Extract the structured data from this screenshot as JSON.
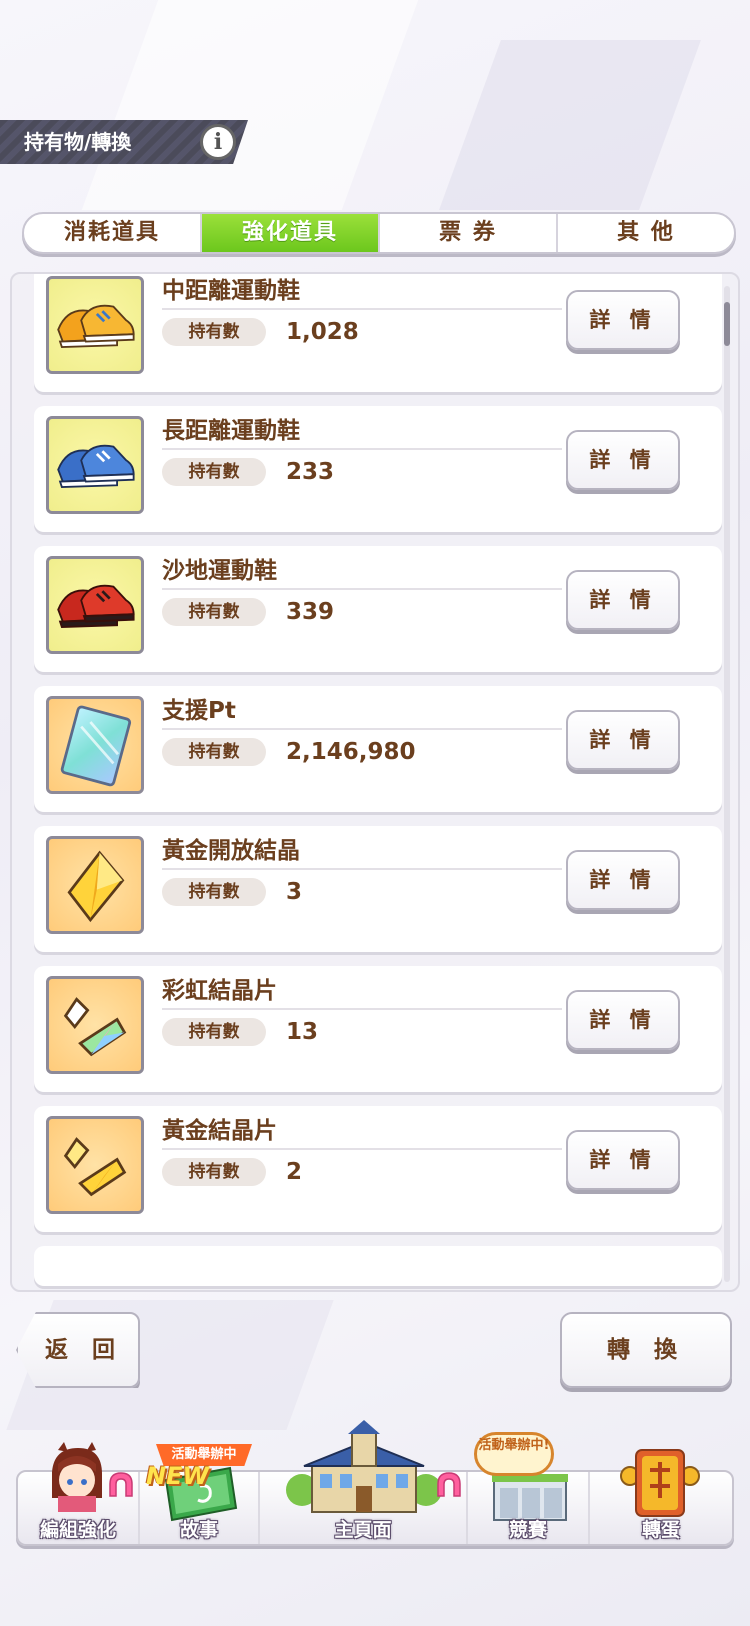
{
  "header": {
    "title": "持有物/轉換",
    "info_icon": "info-icon"
  },
  "tabs": [
    {
      "label": "消耗道具",
      "active": false
    },
    {
      "label": "強化道具",
      "active": true
    },
    {
      "label": "票 券",
      "active": false
    },
    {
      "label": "其 他",
      "active": false
    }
  ],
  "owned_label": "持有數",
  "detail_label": "詳 情",
  "items": [
    {
      "name": "中距離運動鞋",
      "count": "1,028",
      "icon": "orange-sneakers-icon"
    },
    {
      "name": "長距離運動鞋",
      "count": "233",
      "icon": "blue-sneakers-icon"
    },
    {
      "name": "沙地運動鞋",
      "count": "339",
      "icon": "red-sneakers-icon"
    },
    {
      "name": "支援Pt",
      "count": "2,146,980",
      "icon": "support-card-icon"
    },
    {
      "name": "黃金開放結晶",
      "count": "3",
      "icon": "gold-crystal-icon"
    },
    {
      "name": "彩虹結晶片",
      "count": "13",
      "icon": "rainbow-shard-icon"
    },
    {
      "name": "黃金結晶片",
      "count": "2",
      "icon": "gold-shard-icon"
    }
  ],
  "buttons": {
    "back": "返 回",
    "convert": "轉 換"
  },
  "nav": {
    "event_ribbon": "活動舉辦中",
    "new_badge": "NEW",
    "event_bubble": "活動舉辦中!",
    "items": [
      {
        "label": "編組強化",
        "icon": "character-icon"
      },
      {
        "label": "故事",
        "icon": "story-book-icon"
      },
      {
        "label": "主頁面",
        "icon": "home-building-icon"
      },
      {
        "label": "競賽",
        "icon": "race-gate-icon"
      },
      {
        "label": "轉蛋",
        "icon": "gacha-icon"
      }
    ]
  }
}
